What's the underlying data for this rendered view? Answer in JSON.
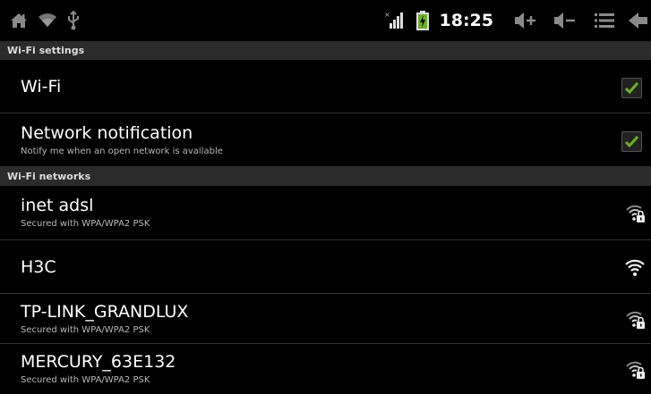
{
  "statusbar": {
    "left_icons": [
      "home-icon",
      "wifi-status-icon",
      "usb-icon"
    ],
    "right_icons": [
      "signal-icon",
      "battery-charging-icon"
    ],
    "time": "18:25",
    "buttons": [
      "volume-up-icon",
      "volume-down-icon",
      "menu-icon",
      "back-icon"
    ],
    "colors": {
      "accent_green": "#6ab41a",
      "background": "#000000",
      "section_header": "#2b2b2b"
    }
  },
  "wifi_settings": {
    "header": "Wi-Fi settings",
    "items": [
      {
        "title": "Wi-Fi",
        "subtitle": "",
        "checked": true
      },
      {
        "title": "Network notification",
        "subtitle": "Notify me when an open network is available",
        "checked": true
      }
    ]
  },
  "wifi_networks": {
    "header": "Wi-Fi networks",
    "items": [
      {
        "name": "inet adsl",
        "subtitle": "Secured with WPA/WPA2 PSK",
        "secured": true,
        "signal": 0.5
      },
      {
        "name": "H3C",
        "subtitle": "",
        "secured": false,
        "signal": 0.75
      },
      {
        "name": "TP-LINK_GRANDLUX",
        "subtitle": "Secured with WPA/WPA2 PSK",
        "secured": true,
        "signal": 0.5
      },
      {
        "name": "MERCURY_63E132",
        "subtitle": "Secured with WPA/WPA2 PSK",
        "secured": true,
        "signal": 0.5
      }
    ]
  }
}
